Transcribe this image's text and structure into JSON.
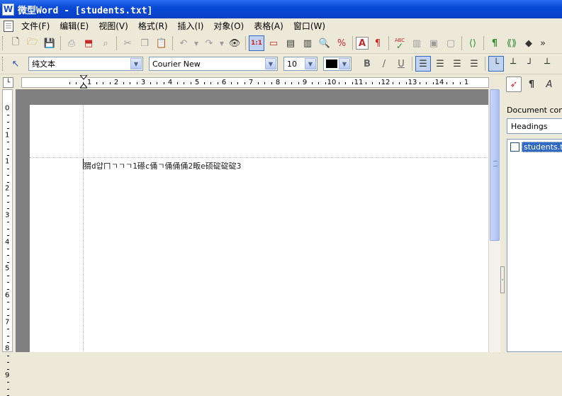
{
  "window": {
    "title": "微型Word - [students.txt]",
    "app_icon": "W"
  },
  "menu": [
    "文件(F)",
    "编辑(E)",
    "视图(V)",
    "格式(R)",
    "插入(I)",
    "对象(O)",
    "表格(A)",
    "窗口(W)"
  ],
  "toolbar1": {
    "zoom_button": "1:1",
    "text_button": "A",
    "spell_check": "ABC",
    "more": "»"
  },
  "toolbar2": {
    "style": "纯文本",
    "font": "Courier New",
    "size": "10",
    "color": "#000000",
    "bold": "B",
    "italic": "/",
    "underline": "U"
  },
  "ruler_h": [
    "1",
    "2",
    "3",
    "4",
    "5",
    "6",
    "7",
    "8",
    "9",
    "10",
    "11",
    "12",
    "13",
    "14",
    "1"
  ],
  "ruler_v": [
    "0",
    "1",
    "1",
    "2",
    "3",
    "4",
    "5",
    "6",
    "7",
    "8",
    "9"
  ],
  "document": {
    "line": "猬d얍ㄇㄱㄱㄱ1礤c俑ㄱ俑俑俑2畈e硕碇碇碇3"
  },
  "side_panel": {
    "label": "Document conte",
    "combo": "Headings",
    "tree_item": "students.tx"
  }
}
